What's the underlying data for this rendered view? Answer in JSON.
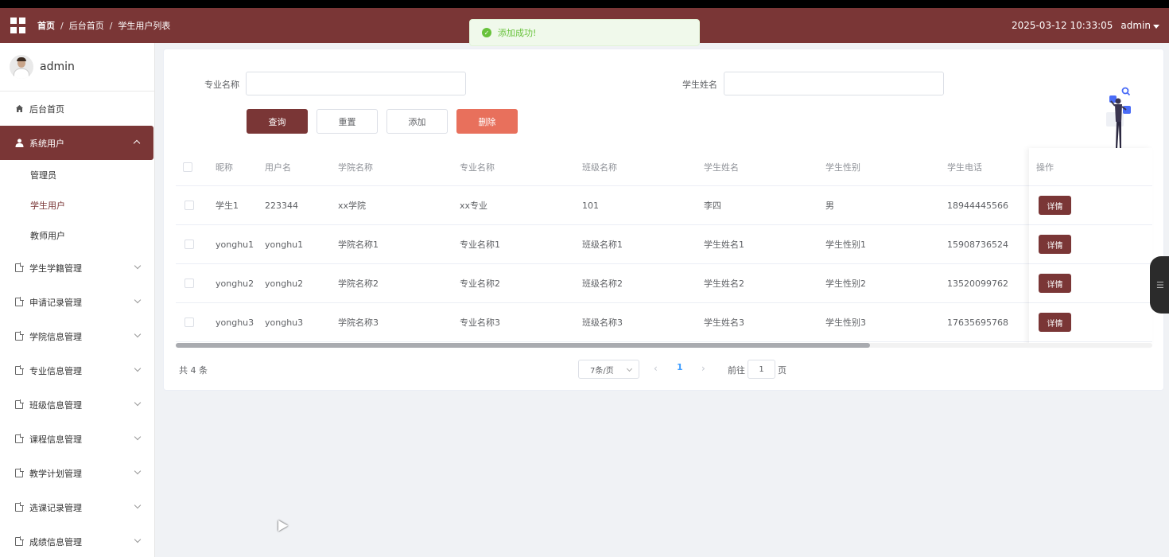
{
  "header": {
    "breadcrumb": {
      "home": "首页",
      "sep": "/",
      "level2": "后台首页",
      "level3": "学生用户列表"
    },
    "datetime": "2025-03-12 10:33:05",
    "username": "admin",
    "grid_icon": "apps-grid-icon",
    "caret_icon": "caret-down-icon"
  },
  "toast": {
    "message": "添加成功!",
    "icon": "check-circle-icon",
    "color": "#67c23a"
  },
  "sidebar": {
    "profile_name": "admin",
    "items": [
      {
        "label": "后台首页",
        "icon": "home-icon"
      },
      {
        "label": "系统用户",
        "icon": "user-icon",
        "active": true,
        "expanded": true,
        "children": [
          {
            "label": "管理员"
          },
          {
            "label": "学生用户",
            "current": true
          },
          {
            "label": "教师用户"
          }
        ]
      },
      {
        "label": "学生学籍管理",
        "icon": "document-icon"
      },
      {
        "label": "申请记录管理",
        "icon": "document-icon"
      },
      {
        "label": "学院信息管理",
        "icon": "document-icon"
      },
      {
        "label": "专业信息管理",
        "icon": "document-icon"
      },
      {
        "label": "班级信息管理",
        "icon": "document-icon"
      },
      {
        "label": "课程信息管理",
        "icon": "document-icon"
      },
      {
        "label": "教学计划管理",
        "icon": "document-icon"
      },
      {
        "label": "选课记录管理",
        "icon": "document-icon"
      },
      {
        "label": "成绩信息管理",
        "icon": "document-icon"
      }
    ]
  },
  "search": {
    "major_label": "专业名称",
    "major_value": "",
    "student_label": "学生姓名",
    "student_value": ""
  },
  "buttons": {
    "query": "查询",
    "reset": "重置",
    "add": "添加",
    "delete": "删除"
  },
  "table": {
    "columns": [
      "昵称",
      "用户名",
      "学院名称",
      "专业名称",
      "班级名称",
      "学生姓名",
      "学生性别",
      "学生电话",
      "操作"
    ],
    "rows": [
      {
        "nickname": "学生1",
        "username": "223344",
        "college": "xx学院",
        "major": "xx专业",
        "class": "101",
        "name": "李四",
        "gender": "男",
        "phone": "18944445566",
        "action": "详情"
      },
      {
        "nickname": "yonghu1",
        "username": "yonghu1",
        "college": "学院名称1",
        "major": "专业名称1",
        "class": "班级名称1",
        "name": "学生姓名1",
        "gender": "学生性别1",
        "phone": "15908736524",
        "action": "详情"
      },
      {
        "nickname": "yonghu2",
        "username": "yonghu2",
        "college": "学院名称2",
        "major": "专业名称2",
        "class": "班级名称2",
        "name": "学生姓名2",
        "gender": "学生性别2",
        "phone": "13520099762",
        "action": "详情"
      },
      {
        "nickname": "yonghu3",
        "username": "yonghu3",
        "college": "学院名称3",
        "major": "专业名称3",
        "class": "班级名称3",
        "name": "学生姓名3",
        "gender": "学生性别3",
        "phone": "17635695768",
        "action": "详情"
      }
    ]
  },
  "pagination": {
    "total": "共 4 条",
    "page_size": "7条/页",
    "prev_icon": "chevron-left-icon",
    "current_page": "1",
    "next_icon": "chevron-right-icon",
    "goto_prefix": "前往",
    "goto_value": "1",
    "goto_suffix": "页"
  },
  "colors": {
    "brand": "#7a3636",
    "danger": "#e8705c",
    "link": "#409eff"
  }
}
